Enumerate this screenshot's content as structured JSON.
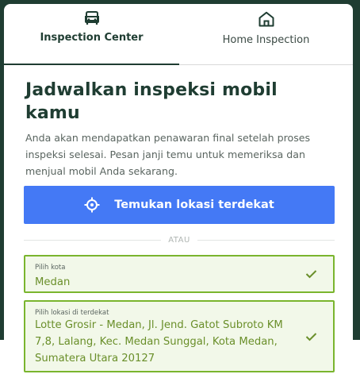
{
  "tabs": [
    {
      "label": "Inspection Center",
      "icon": "car-icon",
      "active": true
    },
    {
      "label": "Home Inspection",
      "icon": "home-icon",
      "active": false
    }
  ],
  "main": {
    "title": "Jadwalkan inspeksi mobil kamu",
    "description": "Anda akan mendapatkan penawaran final setelah proses inspeksi selesai. Pesan janji temu untuk memeriksa dan menjual mobil Anda sekarang.",
    "locate_button": {
      "label": "Temukan lokasi terdekat",
      "icon": "crosshair-icon"
    },
    "divider_text": "ATAU",
    "city_field": {
      "label": "Pilih kota",
      "value": "Medan"
    },
    "location_field": {
      "label": "Pilih lokasi di terdekat",
      "value": "Lotte Grosir - Medan, Jl. Jend. Gatot Subroto KM 7,8, Lalang, Kec. Medan Sunggal, Kota Medan, Sumatera Utara 20127"
    }
  },
  "colors": {
    "brand_dark": "#1f3d32",
    "button_blue": "#4479f5",
    "field_border": "#7ab52e",
    "field_value": "#6a8f2a"
  }
}
